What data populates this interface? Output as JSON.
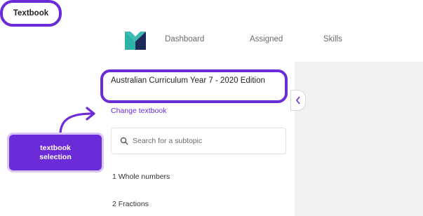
{
  "nav": {
    "dashboard": "Dashboard",
    "assigned": "Assigned",
    "skills": "Skills",
    "textbook": "Textbook"
  },
  "sidebar": {
    "textbook_title": "Australian Curriculum Year 7 - 2020 Edition",
    "change_link": "Change textbook",
    "search_placeholder": "Search for a subtopic",
    "topics": [
      "1 Whole numbers",
      "2 Fractions"
    ]
  },
  "callout": {
    "text": "textbook\nselection"
  },
  "colors": {
    "accent": "#6c2bd9",
    "logo_teal": "#2bb3a8",
    "logo_navy": "#1e2a5a",
    "content_bg": "#f1f1f1"
  },
  "icons": [
    "logo-icon",
    "search-icon",
    "chevron-left-icon"
  ]
}
